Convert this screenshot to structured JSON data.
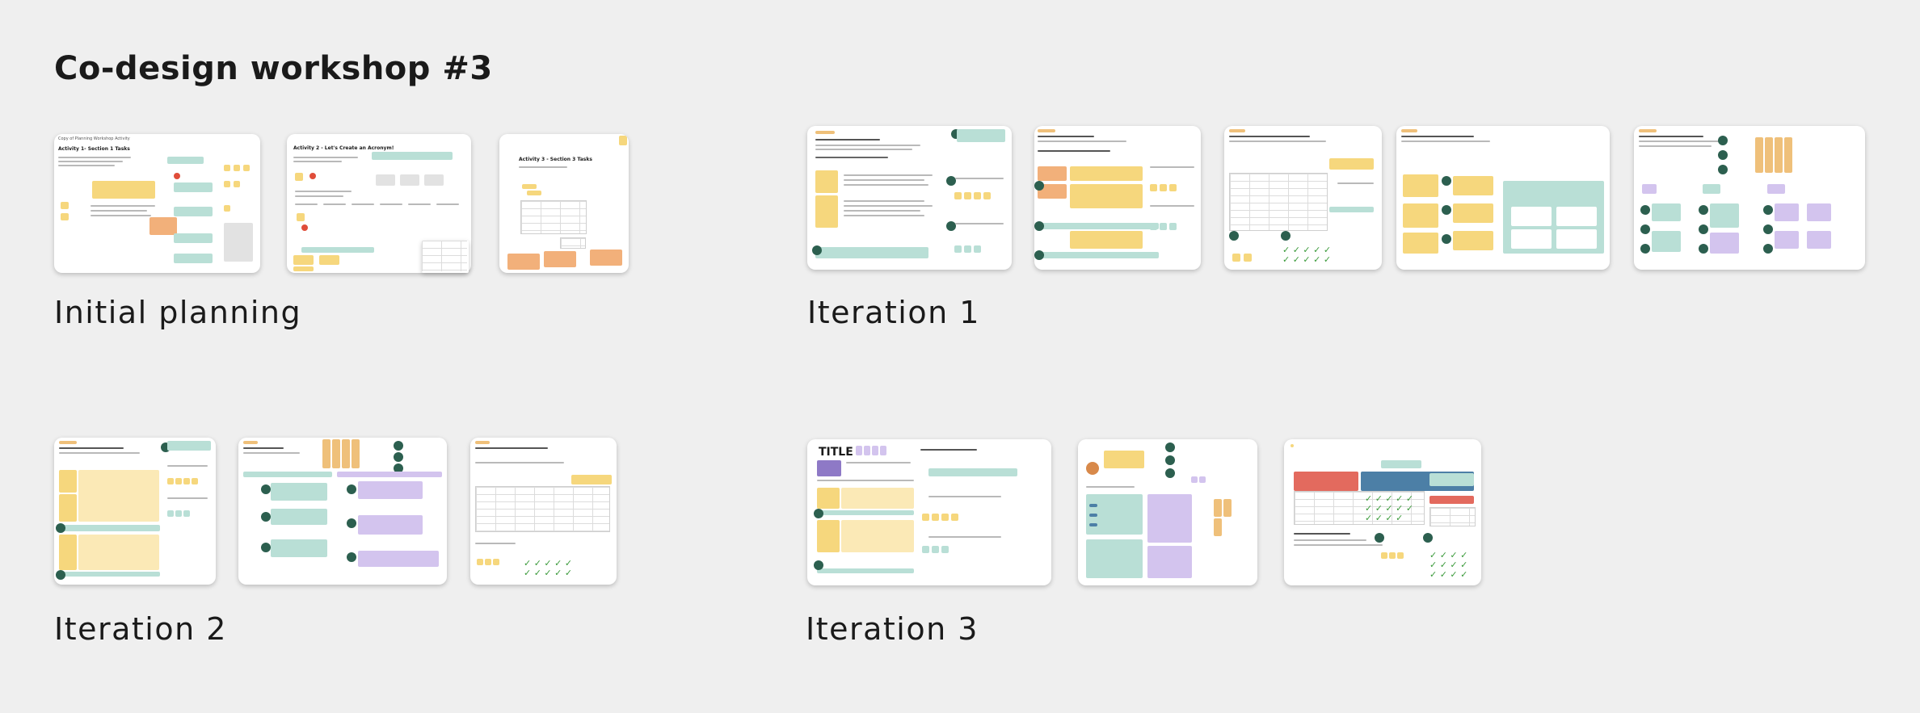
{
  "board": {
    "title": "Co-design workshop #3"
  },
  "sections": {
    "initial_planning": "Initial planning",
    "iteration_1": "Iteration 1",
    "iteration_2": "Iteration 2",
    "iteration_3": "Iteration 3"
  },
  "frames": {
    "ip1": {
      "title": "Copy of Planning Workshop Activity",
      "subtitle": "Activity 1- Section 1 Tasks"
    },
    "ip2": {
      "title": "Activity 2 - Let's Create an Acronym!"
    },
    "ip3": {
      "title": "Activity 3 - Section 3 Tasks"
    },
    "it3_1": {
      "title": "TITLE"
    }
  },
  "colors": {
    "background": "#efefef",
    "sticky_yellow": "#f6d77d",
    "sticky_orange": "#f2b07a",
    "sticky_teal": "#b9dfd6",
    "sticky_purple": "#d3c4ee",
    "sticky_tan": "#efc07a",
    "accent_red": "#e36a5e",
    "accent_blue": "#4c7fa6",
    "dot_green": "#2c5f4f"
  }
}
